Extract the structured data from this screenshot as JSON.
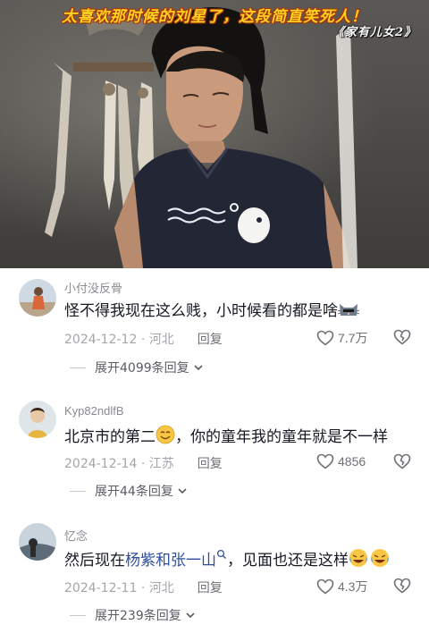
{
  "video": {
    "caption_top": "太喜欢那时候的刘星了，这段简直笑死人！",
    "caption_title": "《家有儿女2》"
  },
  "comments": [
    {
      "username": "小付没反骨",
      "text": "怪不得我现在这么贱，小时候看的都是啥",
      "text_emoji": "cat-face-emoji",
      "date": "2024-12-12",
      "location": "河北",
      "reply_label": "回复",
      "likes": "7.7万",
      "expand_label": "展开4099条回复"
    },
    {
      "username": "Kyp82ndlfB",
      "text_before": "北京市的第二",
      "text_emoji": "smiling-face-emoji",
      "text_after": "，你的童年我的童年就是不一样",
      "date": "2024-12-14",
      "location": "江苏",
      "reply_label": "回复",
      "likes": "4856",
      "expand_label": "展开44条回复"
    },
    {
      "username": "忆念",
      "text_before": "然后现在",
      "text_link": "杨紫和张一山",
      "text_after": "，见面也还是这样",
      "text_emoji": "laughing-crying-emoji",
      "date": "2024-12-11",
      "location": "河北",
      "reply_label": "回复",
      "likes": "4.3万",
      "expand_label": "展开239条回复"
    }
  ],
  "colors": {
    "caption_yellow": "#ffd21f",
    "link_blue": "#2d4f9c",
    "meta_gray": "#a4a5aa"
  }
}
